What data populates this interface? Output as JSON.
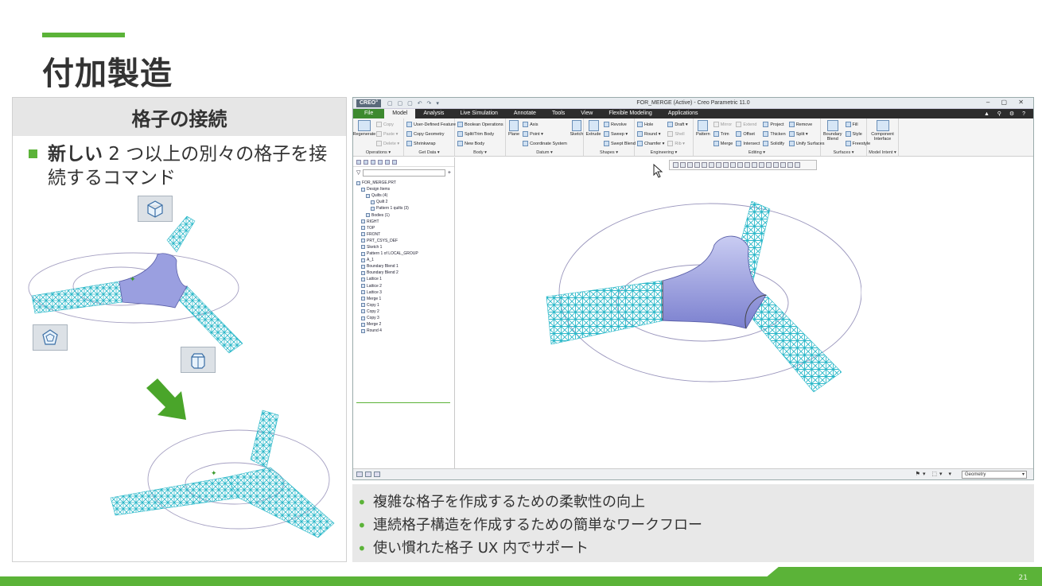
{
  "slide": {
    "title": "付加製造",
    "page_number": "21"
  },
  "left_panel": {
    "header": "格子の接続",
    "feature_bold": "新しい",
    "feature_rest": " 2 つ以上の別々の格子を接続するコマンド"
  },
  "app": {
    "logo": "CREO°",
    "window_title": "FOR_MERGE (Active) - Creo Parametric 11.0",
    "tabs": [
      "File",
      "Model",
      "Analysis",
      "Live Simulation",
      "Annotate",
      "Tools",
      "View",
      "Flexible Modeling",
      "Applications"
    ],
    "active_tab": "Model",
    "ribbon": {
      "operations": {
        "label": "Operations ▾",
        "regenerate": "Regenerate",
        "copy": "Copy",
        "paste": "Paste ▾",
        "delete": "Delete ▾"
      },
      "get_data": {
        "label": "Get Data ▾",
        "udf": "User-Defined Feature",
        "copy_geometry": "Copy Geometry",
        "shrinkwrap": "Shrinkwrap"
      },
      "body": {
        "label": "Body ▾",
        "boolean": "Boolean Operations",
        "split_trim": "Split/Trim Body",
        "new_body": "New Body"
      },
      "datum": {
        "label": "Datum ▾",
        "plane": "Plane",
        "axis": "Axis",
        "point": "Point ▾",
        "csys": "Coordinate System",
        "sketch": "Sketch"
      },
      "shapes": {
        "label": "Shapes ▾",
        "extrude": "Extrude",
        "revolve": "Revolve",
        "sweep": "Sweep ▾",
        "swept_blend": "Swept Blend"
      },
      "engineering": {
        "label": "Engineering ▾",
        "hole": "Hole",
        "round": "Round ▾",
        "chamfer": "Chamfer ▾",
        "draft": "Draft ▾",
        "shell": "Shell",
        "rib": "Rib ▾"
      },
      "editing": {
        "label": "Editing ▾",
        "pattern": "Pattern",
        "mirror": "Mirror",
        "extend": "Extend",
        "trim": "Trim",
        "offset": "Offset",
        "merge": "Merge",
        "intersect": "Intersect",
        "project": "Project",
        "thicken": "Thicken",
        "solidify": "Solidify",
        "remove": "Remove",
        "split": "Split ▾",
        "unify_surfaces": "Unify Surfaces"
      },
      "surfaces": {
        "label": "Surfaces ▾",
        "boundary_blend": "Boundary Blend",
        "fill": "Fill",
        "style": "Style",
        "freestyle": "Freestyle"
      },
      "model_intent": {
        "label": "Model Intent ▾",
        "component_interface": "Component Interface"
      }
    },
    "model_tree": [
      "FOR_MERGE.PRT",
      "Design Items",
      "Quilts (4)",
      "Quilt 2",
      "Pattern 1 quilts (3)",
      "Bodies (1)",
      "RIGHT",
      "TOP",
      "FRONT",
      "PRT_CSYS_DEF",
      "Sketch 1",
      "Pattern 1 of LOCAL_GROUP",
      "A_1",
      "Boundary Blend 1",
      "Boundary Blend 2",
      "Lattice 1",
      "Lattice 2",
      "Lattice 3",
      "Merge 1",
      "Copy 1",
      "Copy 2",
      "Copy 3",
      "Merge 2",
      "Round 4"
    ],
    "status_filter": "Geometry"
  },
  "bullets": [
    "複雑な格子を作成するための柔軟性の向上",
    "連続格子構造を作成するための簡単なワークフロー",
    "使い慣れた格子 UX 内でサポート"
  ],
  "colors": {
    "brand_green": "#5bb338",
    "lattice_cyan": "#2bb8c9",
    "surface_purple": "#8f93d6"
  }
}
